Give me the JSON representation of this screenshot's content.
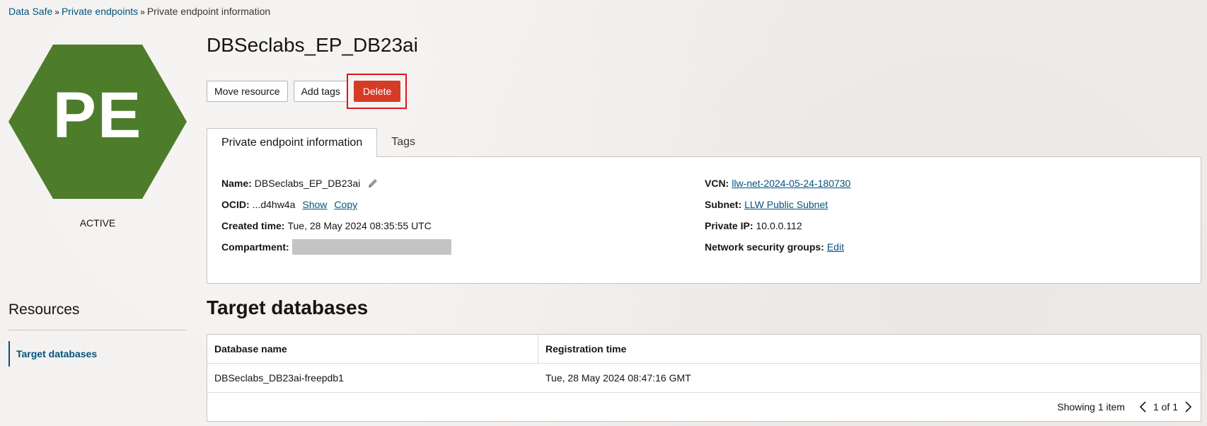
{
  "breadcrumb": {
    "items": [
      "Data Safe",
      "Private endpoints"
    ],
    "separator": "»",
    "current": "Private endpoint information"
  },
  "resource": {
    "icon_text": "PE",
    "icon_color": "#4d7c2b",
    "status": "ACTIVE",
    "title": "DBSeclabs_EP_DB23ai"
  },
  "actions": {
    "move_label": "Move resource",
    "add_tags_label": "Add tags",
    "delete_label": "Delete",
    "delete_color": "#d63b25",
    "highlight_color": "#e0141e"
  },
  "tabs": {
    "info": "Private endpoint information",
    "tags": "Tags"
  },
  "details": {
    "name_label": "Name:",
    "name_value": "DBSeclabs_EP_DB23ai",
    "ocid_label": "OCID:",
    "ocid_value": "...d4hw4a",
    "ocid_show": "Show",
    "ocid_copy": "Copy",
    "created_label": "Created time:",
    "created_value": "Tue, 28 May 2024 08:35:55 UTC",
    "compartment_label": "Compartment:",
    "vcn_label": "VCN:",
    "vcn_value": "llw-net-2024-05-24-180730",
    "subnet_label": "Subnet:",
    "subnet_value": "LLW Public Subnet",
    "private_ip_label": "Private IP:",
    "private_ip_value": "10.0.0.112",
    "nsg_label": "Network security groups:",
    "nsg_edit": "Edit"
  },
  "resources_menu": {
    "title": "Resources",
    "items": [
      "Target databases"
    ]
  },
  "target_databases": {
    "title": "Target databases",
    "columns": [
      "Database name",
      "Registration time"
    ],
    "rows": [
      [
        "DBSeclabs_DB23ai-freepdb1",
        "Tue, 28 May 2024 08:47:16 GMT"
      ]
    ],
    "showing": "Showing 1 item",
    "page_info": "1 of 1"
  }
}
